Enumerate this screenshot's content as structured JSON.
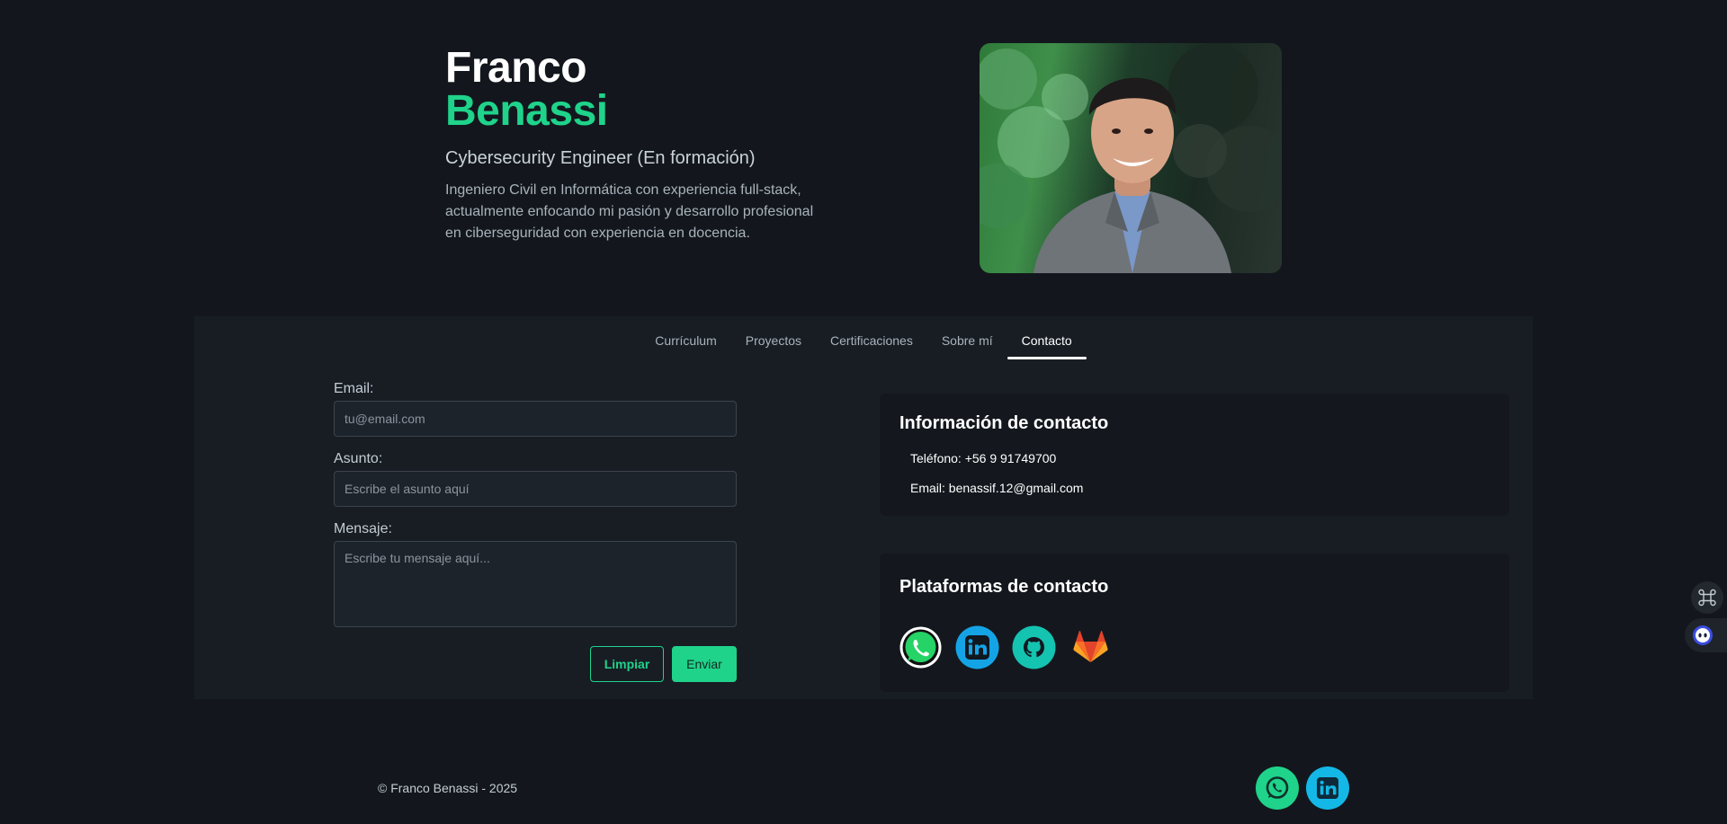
{
  "hero": {
    "first_name": "Franco",
    "last_name": "Benassi",
    "role": "Cybersecurity Engineer (En formación)",
    "description": "Ingeniero Civil en Informática con experiencia full-stack, actualmente enfocando mi pasión y desarrollo profesional en ciberseguridad con experiencia en docencia."
  },
  "tabs": [
    {
      "label": "Currículum",
      "active": false
    },
    {
      "label": "Proyectos",
      "active": false
    },
    {
      "label": "Certificaciones",
      "active": false
    },
    {
      "label": "Sobre mí",
      "active": false
    },
    {
      "label": "Contacto",
      "active": true
    }
  ],
  "form": {
    "email_label": "Email:",
    "email_placeholder": "tu@email.com",
    "subject_label": "Asunto:",
    "subject_placeholder": "Escribe el asunto aquí",
    "message_label": "Mensaje:",
    "message_placeholder": "Escribe tu mensaje aquí...",
    "clear_label": "Limpiar",
    "send_label": "Enviar"
  },
  "contact_info": {
    "title": "Información de contacto",
    "phone": "Teléfono: +56 9 91749700",
    "email": "Email: benassif.12@gmail.com"
  },
  "platforms": {
    "title": "Plataformas de contacto",
    "items": [
      {
        "icon": "whatsapp-icon",
        "color": "#25d366"
      },
      {
        "icon": "linkedin-icon",
        "color": "#14a4e6"
      },
      {
        "icon": "github-icon",
        "color": "#14c3b0"
      },
      {
        "icon": "gitlab-icon",
        "color": "#e2432a"
      }
    ]
  },
  "footer": {
    "copyright": "© Franco Benassi - 2025"
  },
  "colors": {
    "accent": "#1fd38b",
    "background": "#13171d",
    "panel": "#181d24"
  }
}
